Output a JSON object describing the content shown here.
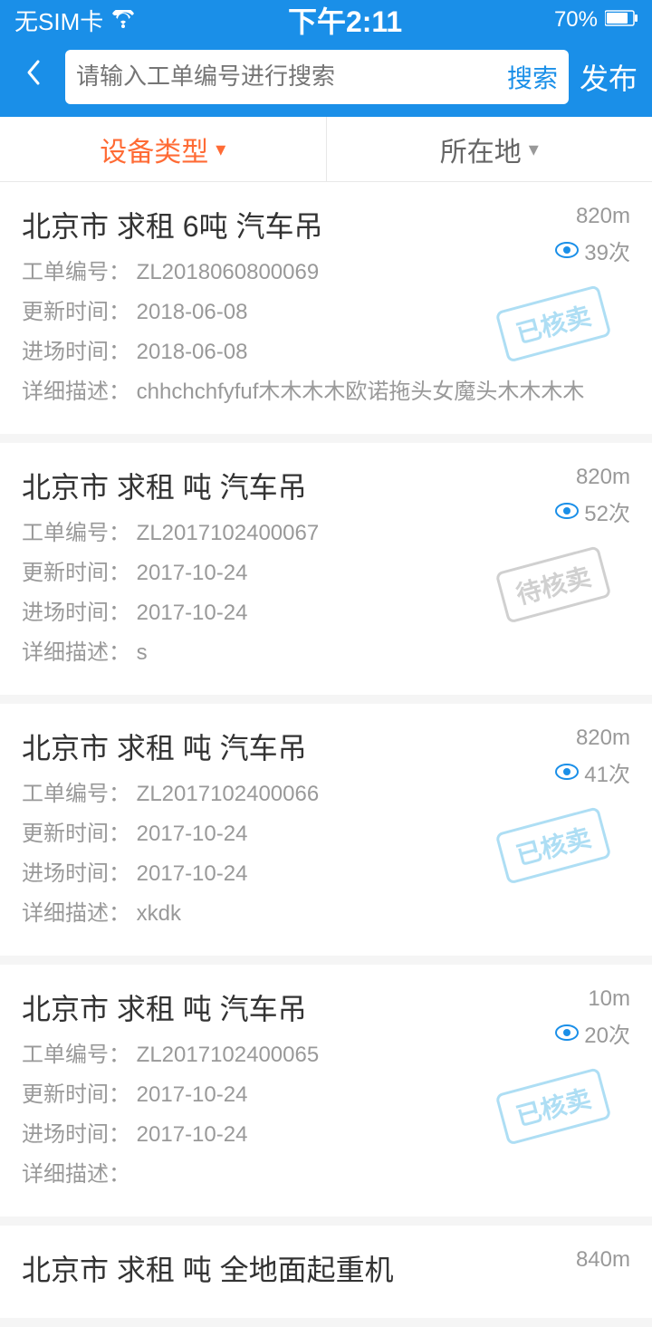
{
  "statusBar": {
    "left": "无SIM卡 ☁",
    "center": "下午2:11",
    "right": "70%"
  },
  "header": {
    "backLabel": "‹",
    "searchPlaceholder": "请输入工单编号进行搜索",
    "searchBtnLabel": "搜索",
    "publishBtnLabel": "发布"
  },
  "filterBar": {
    "deviceTypeLabel": "设备类型",
    "locationLabel": "所在地"
  },
  "items": [
    {
      "title": "北京市 求租 6吨 汽车吊",
      "distance": "820m",
      "orderNo": "ZL2018060800069",
      "views": "39次",
      "updateTime": "2018-06-08",
      "entryTime": "2018-06-08",
      "description": "chhchchfyfuf木木木木欧诺拖头女魔头木木木木",
      "stamp": "已核卖",
      "stampType": "sold"
    },
    {
      "title": "北京市 求租 吨 汽车吊",
      "distance": "820m",
      "orderNo": "ZL2017102400067",
      "views": "52次",
      "updateTime": "2017-10-24",
      "entryTime": "2017-10-24",
      "description": "s",
      "stamp": "待核卖",
      "stampType": "pending"
    },
    {
      "title": "北京市 求租 吨 汽车吊",
      "distance": "820m",
      "orderNo": "ZL2017102400066",
      "views": "41次",
      "updateTime": "2017-10-24",
      "entryTime": "2017-10-24",
      "description": "xkdk",
      "stamp": "已核卖",
      "stampType": "sold"
    },
    {
      "title": "北京市 求租 吨 汽车吊",
      "distance": "10m",
      "orderNo": "ZL2017102400065",
      "views": "20次",
      "updateTime": "2017-10-24",
      "entryTime": "2017-10-24",
      "description": "",
      "stamp": "已核卖",
      "stampType": "sold"
    },
    {
      "title": "北京市 求租 吨 全地面起重机",
      "distance": "840m",
      "orderNo": "",
      "views": "",
      "updateTime": "",
      "entryTime": "",
      "description": "",
      "stamp": "",
      "stampType": ""
    }
  ],
  "labels": {
    "orderNo": "工单编号：",
    "updateTime": "更新时间：",
    "entryTime": "进场时间：",
    "description": "详细描述："
  }
}
